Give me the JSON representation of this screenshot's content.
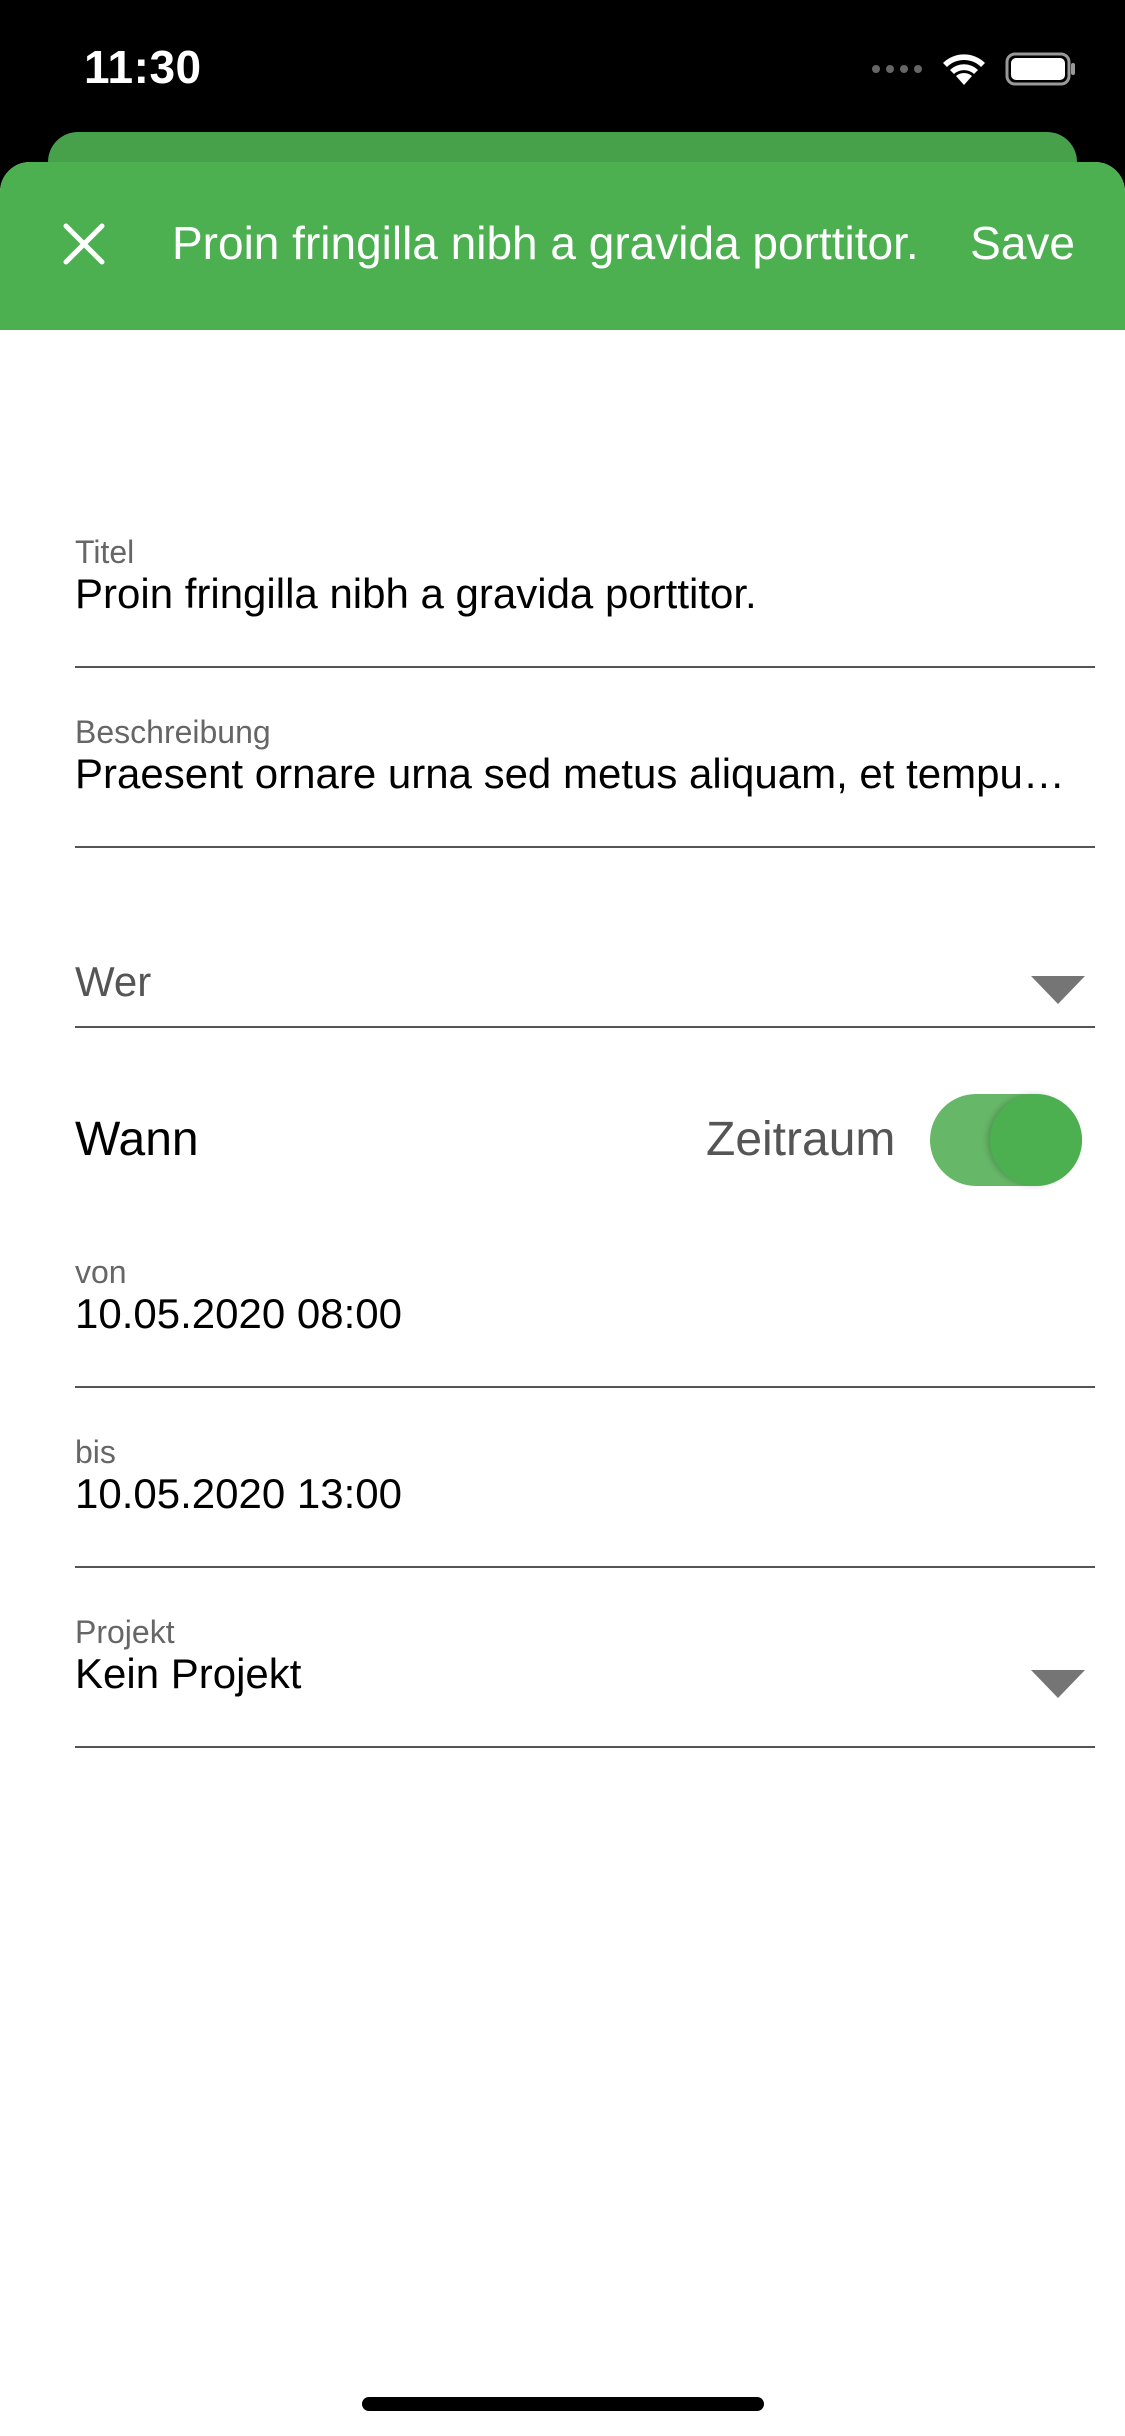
{
  "status_bar": {
    "time": "11:30",
    "icons": [
      "cellular-dots-icon",
      "wifi-icon",
      "battery-icon"
    ]
  },
  "app_bar": {
    "title": "Proin fringilla nibh a gravida porttitor.",
    "save_label": "Save",
    "close_icon": "close-icon",
    "background_color": "#4caf50"
  },
  "form": {
    "titel": {
      "label": "Titel",
      "value": "Proin fringilla nibh a gravida porttitor."
    },
    "beschreibung": {
      "label": "Beschreibung",
      "value": "Praesent ornare urna sed metus aliquam, et tempus odio pretium."
    },
    "wer": {
      "placeholder": "Wer"
    },
    "wann": {
      "label": "Wann",
      "zeitraum_label": "Zeitraum",
      "zeitraum_enabled": true
    },
    "von": {
      "label": "von",
      "value": "10.05.2020 08:00"
    },
    "bis": {
      "label": "bis",
      "value": "10.05.2020 13:00"
    },
    "projekt": {
      "label": "Projekt",
      "value": "Kein Projekt"
    }
  }
}
